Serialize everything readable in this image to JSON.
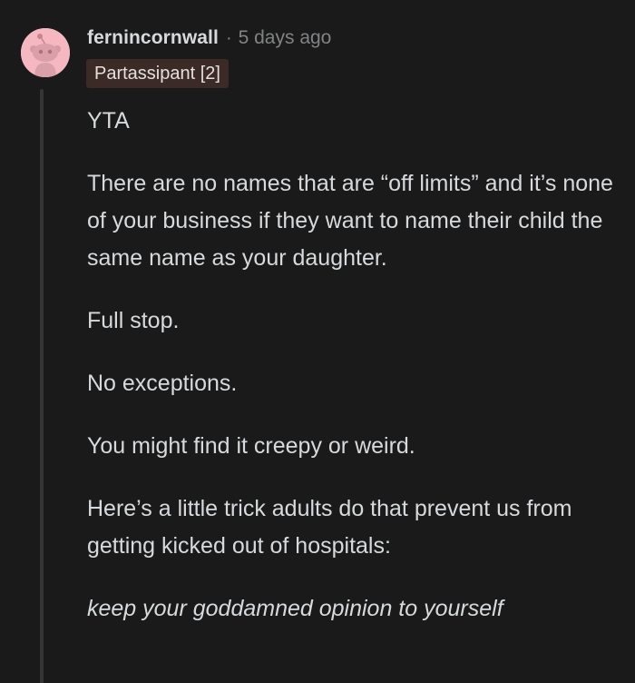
{
  "comment": {
    "username": "fernincornwall",
    "separator": "·",
    "timestamp": "5 days ago",
    "flair": "Partassipant [2]",
    "avatar_icon": "reddit-snoo-avatar-icon",
    "colors": {
      "background": "#1a1a1b",
      "avatar_bg": "#f5b7c0",
      "flair_bg": "#3b2a25",
      "text": "#d7dadc",
      "muted": "#818384"
    },
    "paragraphs": [
      "YTA",
      "There are no names that are “off limits” and it’s none of your business if they want to name their child the same name as your daughter.",
      "Full stop.",
      "No exceptions.",
      "You might find it creepy or weird.",
      "Here’s a little trick adults do that prevent us from getting kicked out of hospitals:",
      "keep your goddamned opinion to yourself"
    ]
  }
}
